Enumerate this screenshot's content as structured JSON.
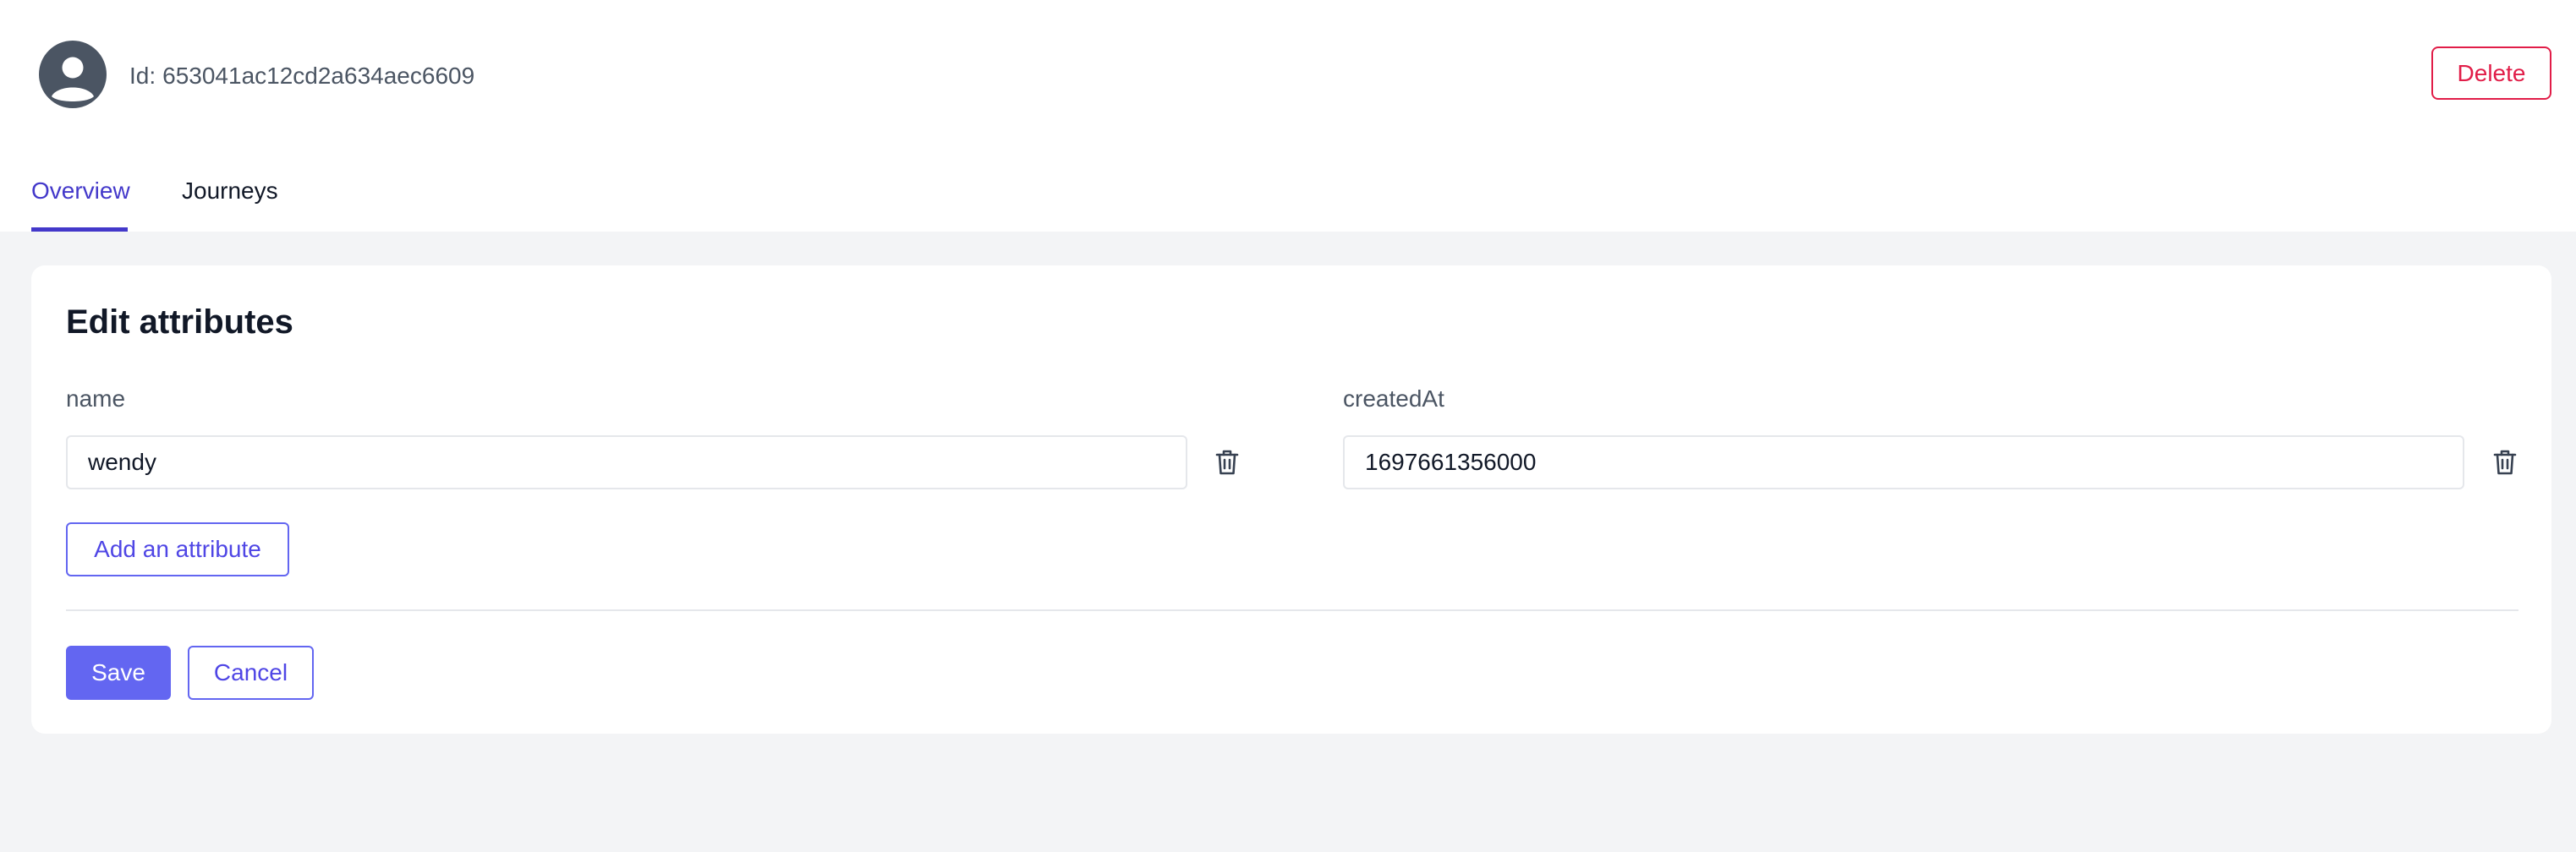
{
  "header": {
    "avatar_icon": "user-circle-icon",
    "id_prefix": "Id:",
    "id_value": "653041ac12cd2a634aec6609",
    "delete_label": "Delete"
  },
  "tabs": [
    {
      "label": "Overview",
      "active": true
    },
    {
      "label": "Journeys",
      "active": false
    }
  ],
  "attributes_card": {
    "title": "Edit attributes",
    "attributes": [
      {
        "key": "name",
        "value": "wendy",
        "delete_icon": "trash-icon"
      },
      {
        "key": "createdAt",
        "value": "1697661356000",
        "delete_icon": "trash-icon"
      }
    ],
    "add_label": "Add an attribute",
    "save_label": "Save",
    "cancel_label": "Cancel"
  },
  "colors": {
    "accent": "#6366f1",
    "accent_text": "#4f46e5",
    "tab_active": "#4338ca",
    "danger": "#e11d48",
    "page_background": "#f3f4f6"
  }
}
